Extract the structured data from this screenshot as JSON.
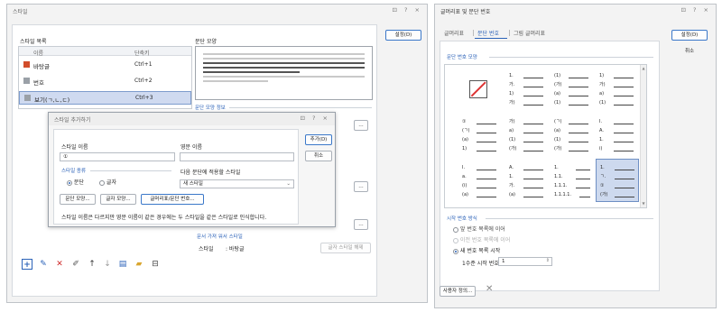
{
  "left_window": {
    "title": "스타일",
    "controls": "⊡ ? ×",
    "style_list_label": "스타일 목록",
    "col_name": "이름",
    "col_shortcut": "단축키",
    "styles": [
      {
        "name": "바탕글",
        "shortcut": "Ctrl+1"
      },
      {
        "name": "번호",
        "shortcut": "Ctrl+2"
      },
      {
        "name": "보기(ㄱ,ㄴ,ㄷ)",
        "shortcut": "Ctrl+3"
      }
    ],
    "para_shape_label": "문단 모양",
    "para_info_label": "문단 모양 정보",
    "set_button": "설정(D)",
    "char_info_title": "문서 가져 워서 스타일",
    "char_info_style_label": "스타일",
    "char_info_style_value": ": 바탕글",
    "char_style_btn": "글자 스타일 해제"
  },
  "add_dialog": {
    "title": "스타일 추가하기",
    "controls": "⊡ ? ×",
    "style_name_label": "스타일 이름",
    "style_name_value": "①",
    "english_name_label": "영문 이름",
    "style_kind_label": "스타일 종류",
    "kind_para": "문단",
    "kind_char": "글자",
    "next_style_label": "다음 문단에 적용할 스타일",
    "next_style_value": "새 스타일",
    "btn_para_shape": "문단 모양...",
    "btn_char_shape": "글자 모양...",
    "btn_bullet": "글머리표/문단 번호...",
    "add_button": "추가(D)",
    "cancel_button": "취소",
    "note": "스타일 이름은 다르지만 영문 이름이 같은 경우에는 두 스타일을 같은 스타일로 인식합니다."
  },
  "right_window": {
    "title": "글머리표 및 문단 번호",
    "controls": "⊡ ? ×",
    "tabs": [
      "글머리표",
      "문단 번호",
      "그림 글머리표"
    ],
    "number_shape_label": "문단 번호 모양",
    "set_button": "설정(D)",
    "cancel_button": "취소",
    "start_label": "시작 번호 방식",
    "opt_prev_list": "앞 번호 목록에 이어",
    "opt_prev_level": "이전 번호 목록에 이어",
    "opt_new_list": "새 번호 목록 시작",
    "start_level_label": "1수준 시작 번호",
    "start_level_value": "1",
    "custom_button": "사용자 정의...",
    "cells": [
      {
        "lines": []
      },
      {
        "lines": [
          "1.",
          "가.",
          "1)",
          "가)"
        ]
      },
      {
        "lines": [
          "(1)",
          "(가)",
          "(a)",
          "(1)"
        ]
      },
      {
        "lines": [
          "1)",
          "가)",
          "a)",
          "(1)"
        ]
      },
      {
        "lines": [
          "①",
          "(ㄱ)",
          "(a)",
          "1)"
        ]
      },
      {
        "lines": [
          "가)",
          "a)",
          "(1)",
          "(가)"
        ]
      },
      {
        "lines": [
          "(ㄱ)",
          "(a)",
          "(1)",
          "(가)"
        ]
      },
      {
        "lines": [
          "I.",
          "A.",
          "1.",
          "i)"
        ]
      },
      {
        "lines": [
          "I.",
          "a.",
          "(i)",
          "(a)"
        ]
      },
      {
        "lines": [
          "A.",
          "1.",
          "가.",
          "(a)"
        ]
      },
      {
        "lines": [
          "1.",
          "1.1.",
          "1.1.1.",
          "1.1.1.1."
        ]
      },
      {
        "lines": [
          "1.",
          "ㄱ.",
          "①",
          "(가)"
        ]
      }
    ]
  }
}
